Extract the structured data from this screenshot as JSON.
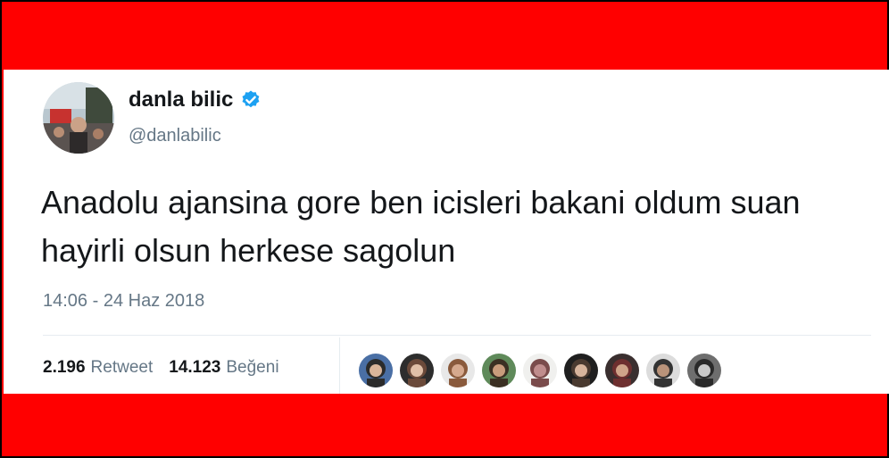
{
  "tweet": {
    "display_name": "danla bilic",
    "handle": "@danlabilic",
    "verified_icon": "verified-badge-icon",
    "text": "Anadolu ajansina gore ben icisleri bakani oldum suan hayirli olsun herkese sagolun",
    "timestamp": "14:06 - 24 Haz 2018"
  },
  "stats": {
    "retweets": {
      "count": "2.196",
      "label": "Retweet"
    },
    "likes": {
      "count": "14.123",
      "label": "Beğeni"
    }
  },
  "liked_by_avatars": [
    {
      "name": "liker-avatar-1"
    },
    {
      "name": "liker-avatar-2"
    },
    {
      "name": "liker-avatar-3"
    },
    {
      "name": "liker-avatar-4"
    },
    {
      "name": "liker-avatar-5"
    },
    {
      "name": "liker-avatar-6"
    },
    {
      "name": "liker-avatar-7"
    },
    {
      "name": "liker-avatar-8"
    },
    {
      "name": "liker-avatar-9"
    }
  ],
  "colors": {
    "frame": "#ff0000",
    "card": "#ffffff",
    "verified": "#1da1f2",
    "secondary_text": "#657786",
    "primary_text": "#14171a"
  }
}
